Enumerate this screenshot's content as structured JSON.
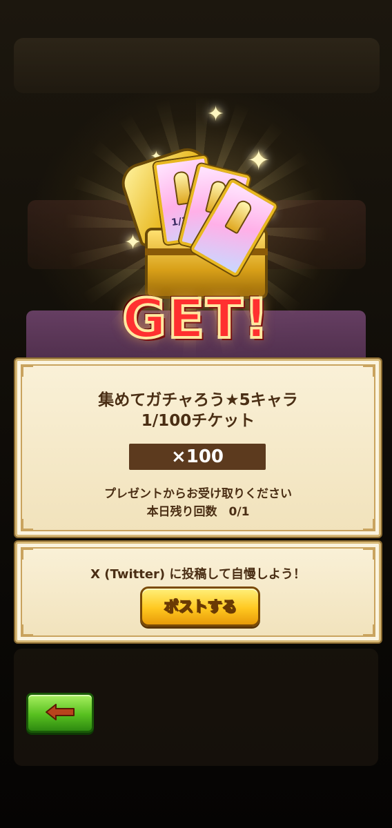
{
  "result": {
    "get_label": "GET!",
    "item_name_line1": "集めてガチャろう★5キャラ",
    "item_name_line2": "1/100チケット",
    "quantity": "×100",
    "receive_instruction": "プレゼントからお受け取りください",
    "remaining_label": "本日残り回数　0/1",
    "ticket_label": "1/100"
  },
  "share": {
    "prompt": "X (Twitter) に投稿して自慢しよう！",
    "post_button_label": "ポストする"
  },
  "navigation": {
    "back_icon": "back-arrow-icon"
  },
  "colors": {
    "panel_bg": "#f6ead0",
    "panel_border": "#c9a35e",
    "text_brown": "#4a2e14",
    "quantity_bar": "#5c3a1e",
    "post_button": "#ffc820",
    "back_button": "#58c020",
    "get_red": "#ff3030"
  }
}
